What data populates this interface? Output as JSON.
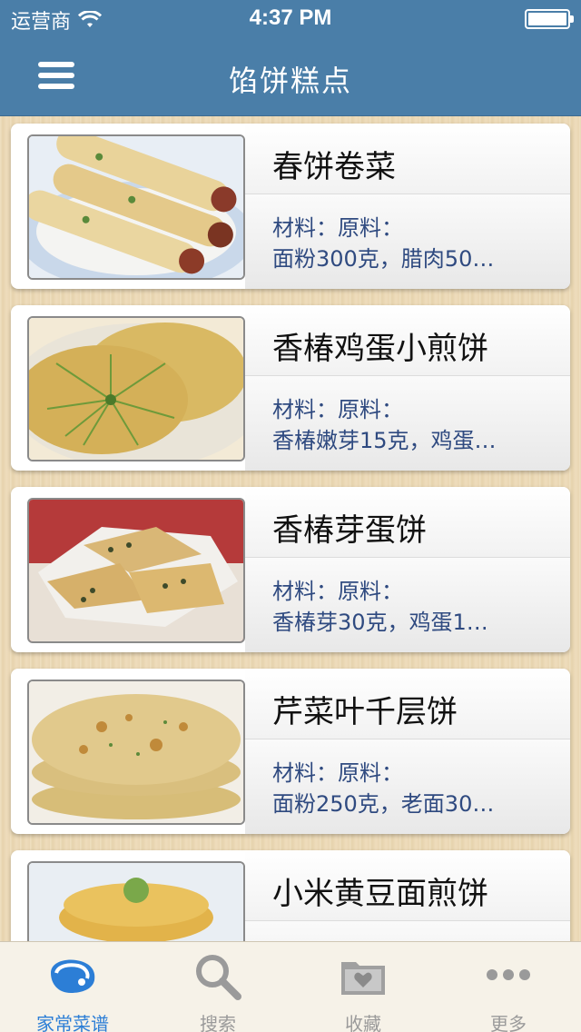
{
  "status_bar": {
    "carrier": "运营商",
    "time": "4:37 PM"
  },
  "nav": {
    "title": "馅饼糕点"
  },
  "recipes": [
    {
      "title": "春饼卷菜",
      "desc_line1": "材料：原料：",
      "desc_line2": "面粉300克，腊肉50…"
    },
    {
      "title": "香椿鸡蛋小煎饼",
      "desc_line1": "材料：原料：",
      "desc_line2": "香椿嫩芽15克，鸡蛋…"
    },
    {
      "title": "香椿芽蛋饼",
      "desc_line1": "材料：原料：",
      "desc_line2": "香椿芽30克，鸡蛋1…"
    },
    {
      "title": "芹菜叶千层饼",
      "desc_line1": "材料：原料：",
      "desc_line2": "面粉250克，老面30…"
    },
    {
      "title": "小米黄豆面煎饼",
      "desc_line1": "",
      "desc_line2": ""
    }
  ],
  "tabs": [
    {
      "label": "家常菜谱",
      "icon": "meat-icon",
      "active": true
    },
    {
      "label": "搜索",
      "icon": "search-icon",
      "active": false
    },
    {
      "label": "收藏",
      "icon": "favorites-folder-icon",
      "active": false
    },
    {
      "label": "更多",
      "icon": "more-dots-icon",
      "active": false
    }
  ],
  "colors": {
    "nav_bg": "#4a7ea8",
    "tab_active": "#2c7ed6",
    "desc_text": "#2f4a80"
  }
}
